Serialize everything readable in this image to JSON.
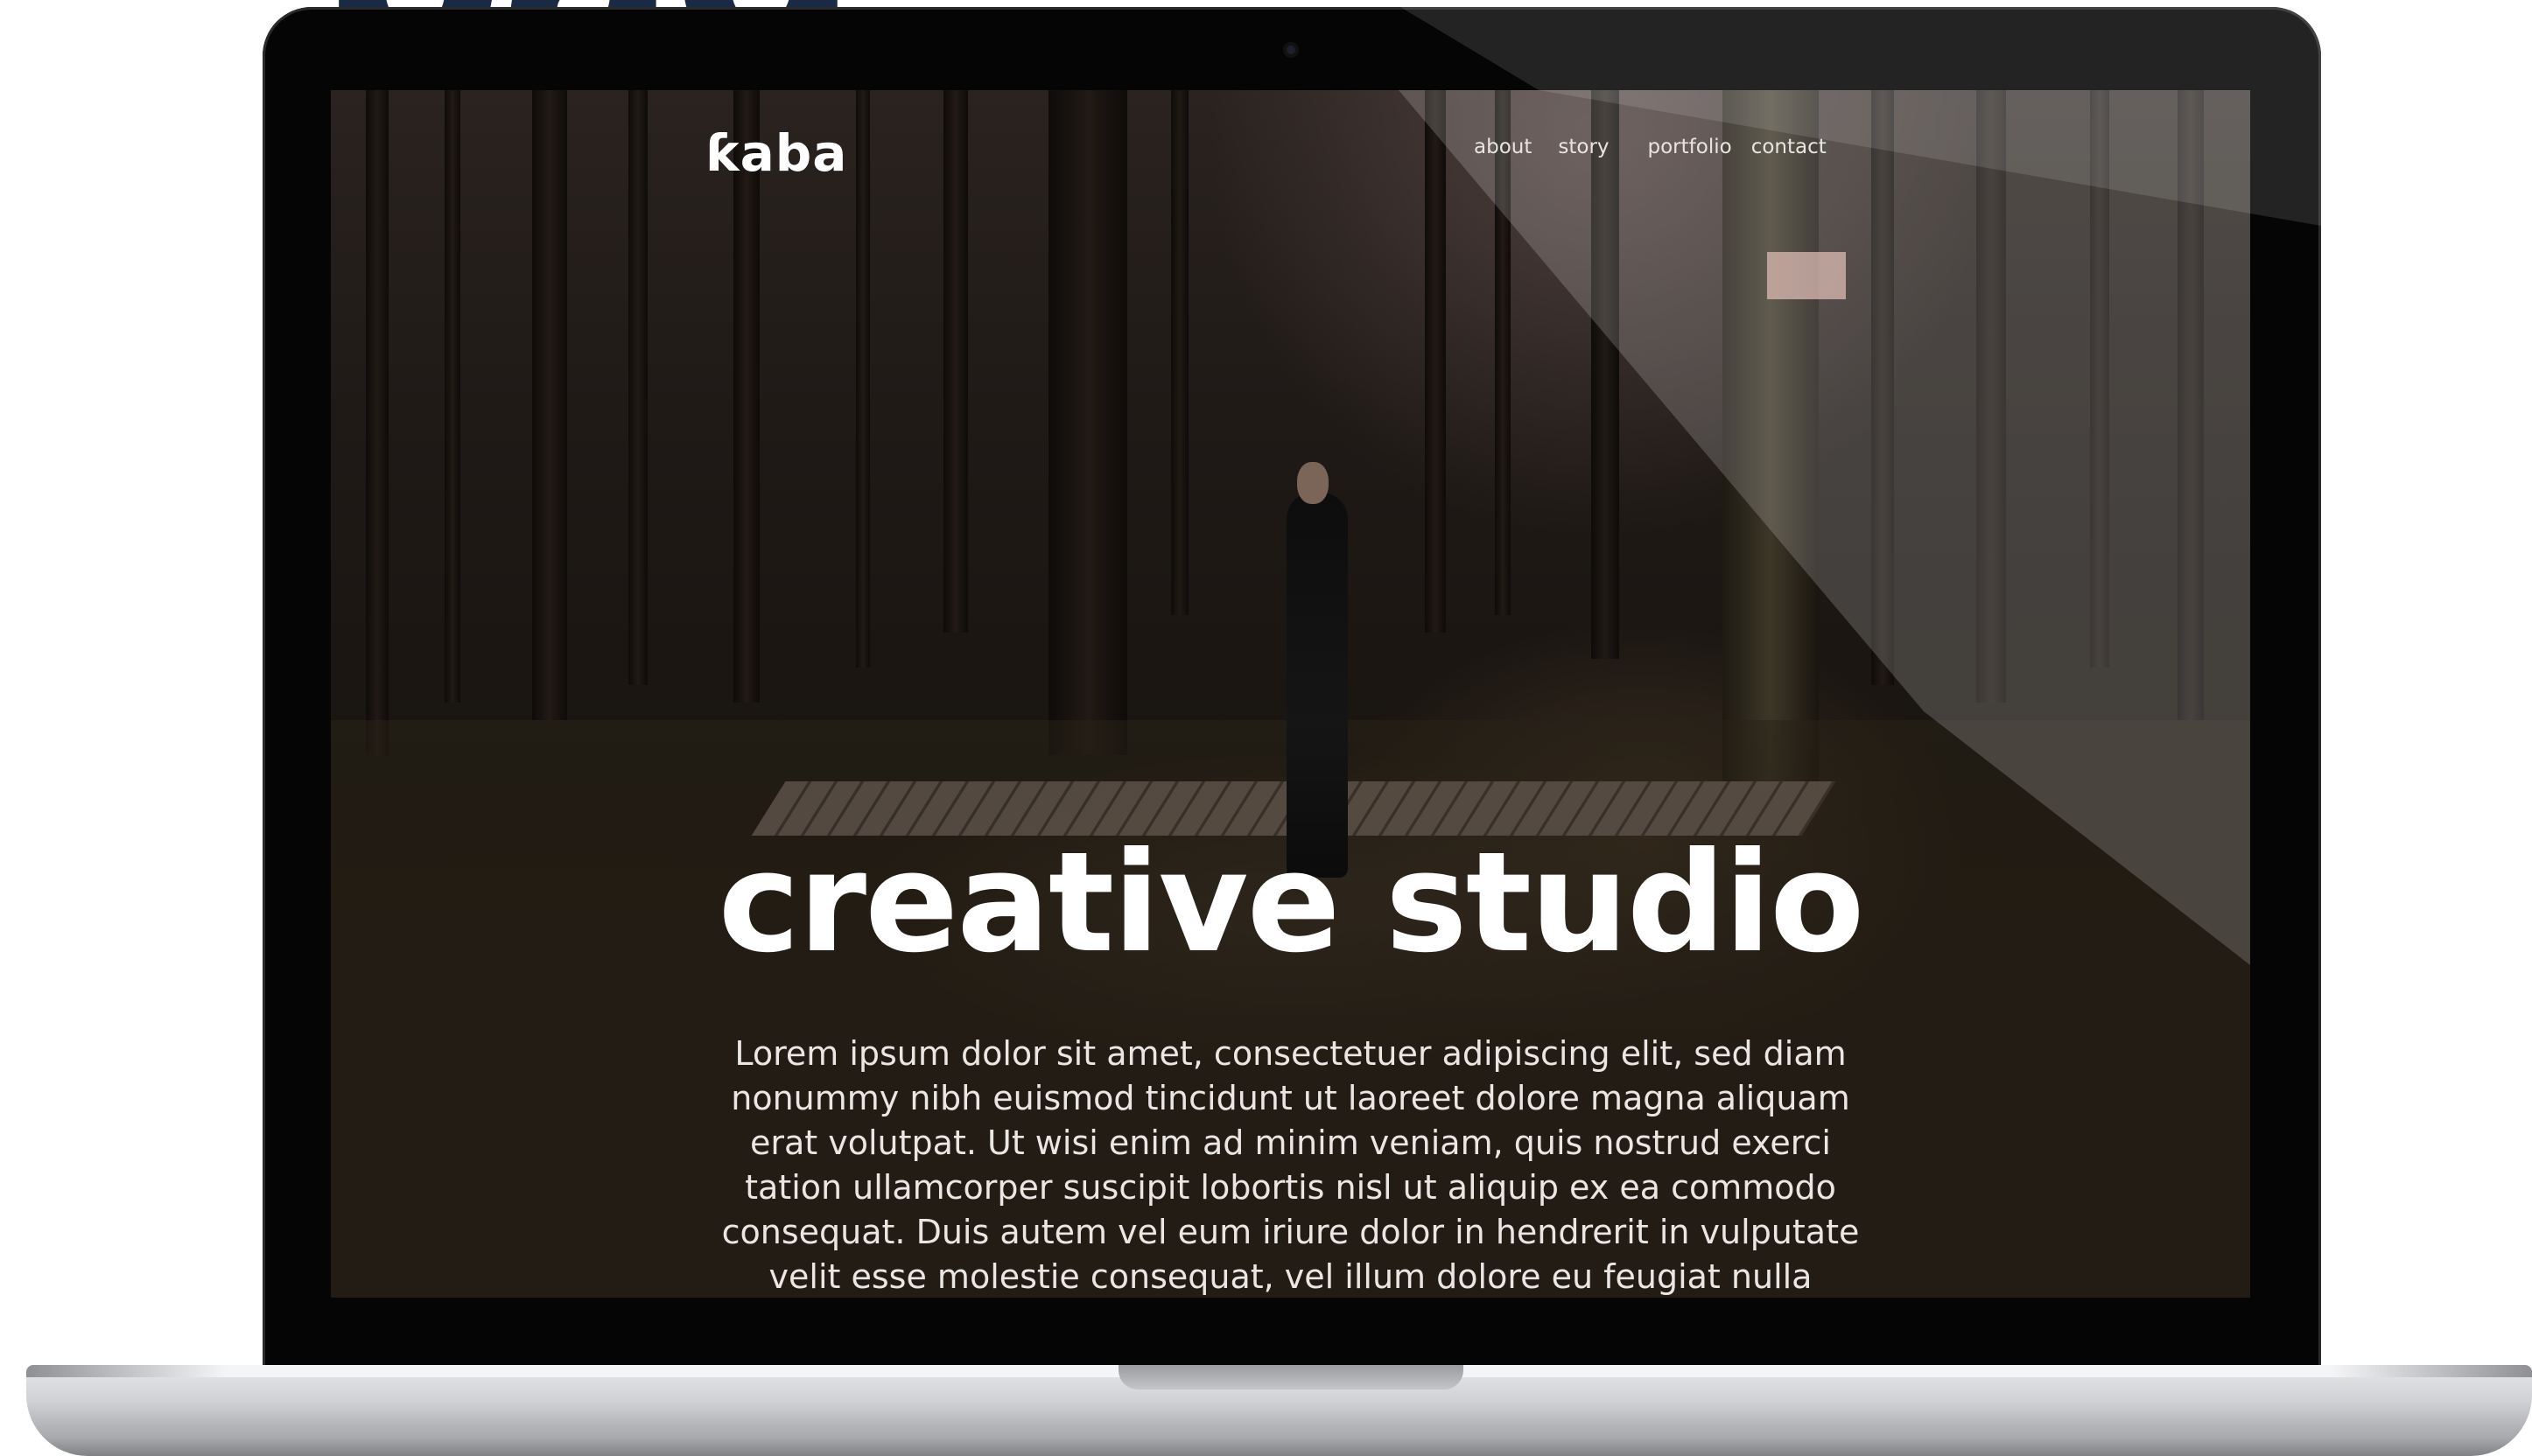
{
  "backdrop": {
    "heading_fragment": "pag"
  },
  "site": {
    "logo": "ƙaba",
    "nav": [
      {
        "label": "about"
      },
      {
        "label": "story"
      },
      {
        "label": "portfolio"
      },
      {
        "label": "contact"
      }
    ],
    "hero_title": "creative studio",
    "hero_body_lines": [
      "Lorem ipsum dolor sit amet, consectetuer adipiscing elit, sed diam",
      "nonummy nibh euismod tincidunt ut laoreet dolore magna aliquam",
      "erat volutpat. Ut wisi enim ad minim veniam, quis nostrud exerci",
      "tation ullamcorper suscipit lobortis nisl ut aliquip ex ea commodo",
      "consequat. Duis autem vel eum iriure dolor in hendrerit in vulputate",
      "velit esse molestie consequat, vel illum dolore eu feugiat nulla"
    ]
  },
  "colors": {
    "backdrop_heading": "#1b2a44",
    "bezel": "#050505",
    "hero_text": "#ffffff",
    "body_text": "#e9e6e4",
    "laptop_base": "#cfd1d4"
  }
}
